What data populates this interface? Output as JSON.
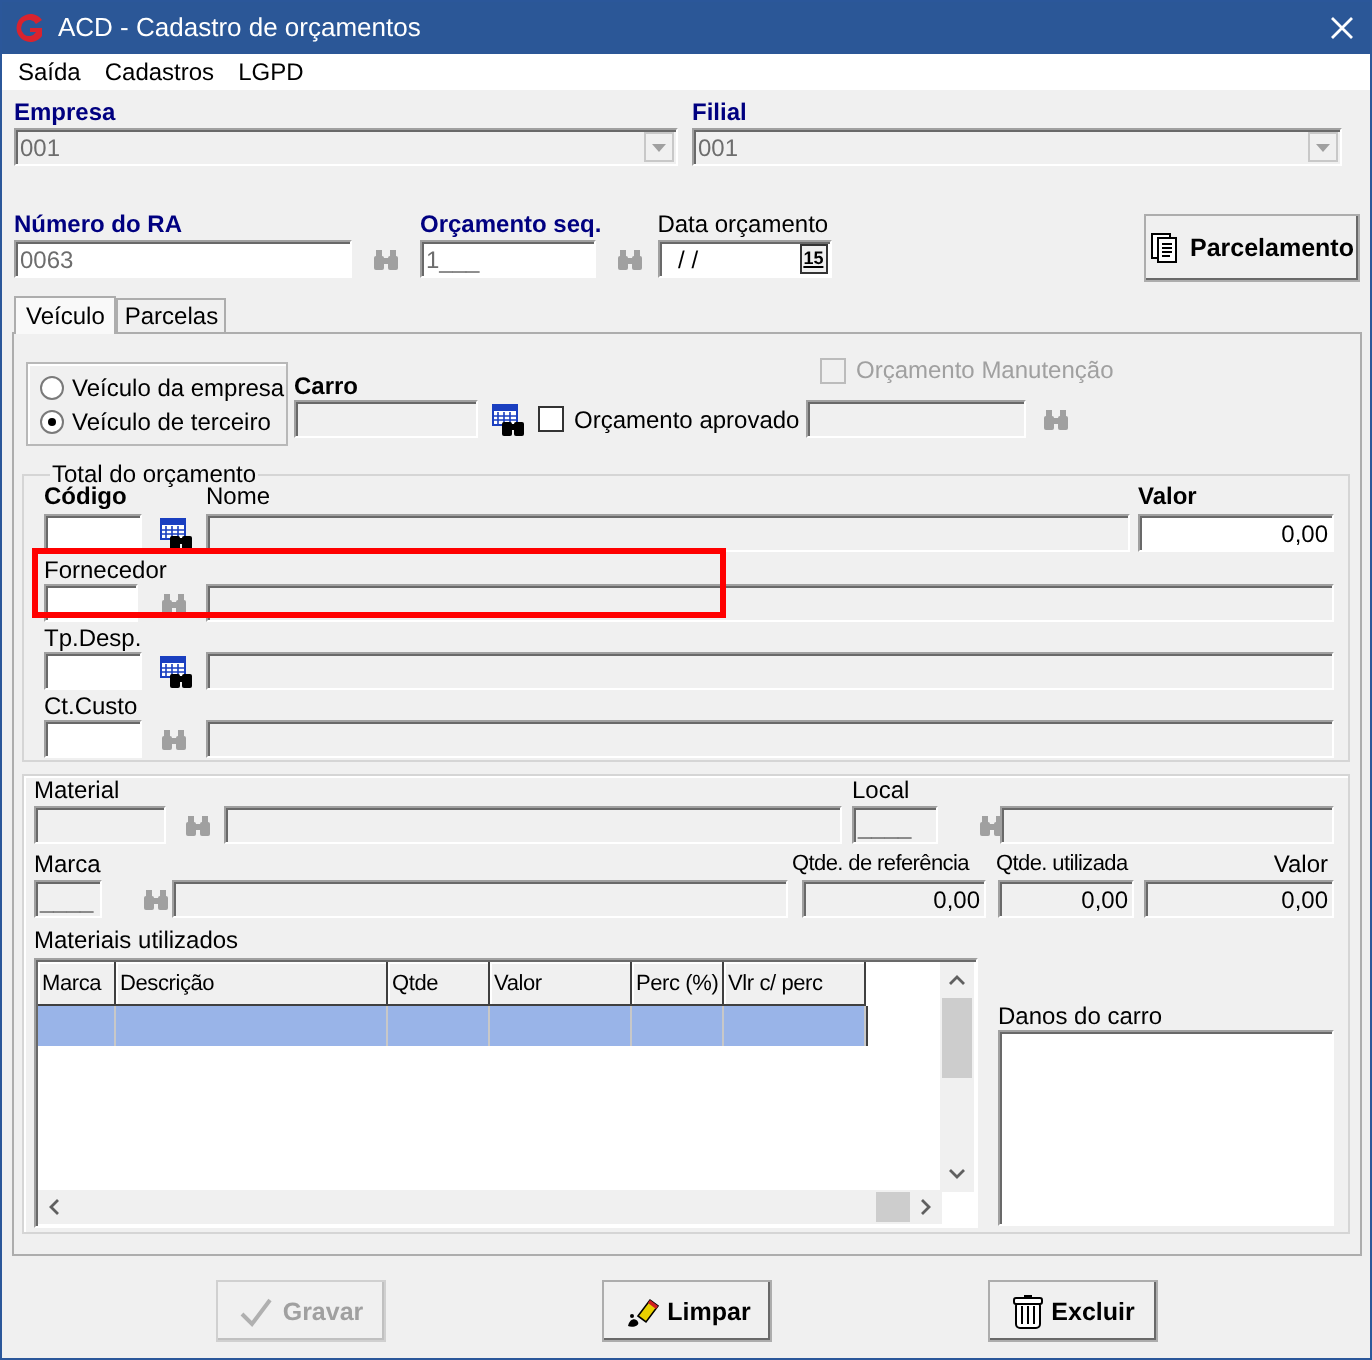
{
  "window": {
    "title": "ACD - Cadastro de orçamentos"
  },
  "menu": [
    "Saída",
    "Cadastros",
    "LGPD"
  ],
  "empresa": {
    "label": "Empresa",
    "value": "001",
    "disabled": true
  },
  "filial": {
    "label": "Filial",
    "value": "001",
    "disabled": true
  },
  "numero_ra": {
    "label": "Número do RA",
    "value": "0063"
  },
  "orcamento_seq": {
    "label": "Orçamento seq.",
    "value": "1___"
  },
  "data_orcamento": {
    "label": "Data orçamento",
    "value": " / /",
    "calendar_day": "15"
  },
  "parcelamento_button": "Parcelamento",
  "tabs": [
    {
      "label": "Veículo",
      "selected": true
    },
    {
      "label": "Parcelas",
      "selected": false
    }
  ],
  "vehicle_type": [
    {
      "label": "Veículo da empresa",
      "selected": false
    },
    {
      "label": "Veículo de terceiro",
      "selected": true
    }
  ],
  "carro": {
    "label": "Carro"
  },
  "orcamento_manutencao": {
    "label": "Orçamento Manutenção",
    "checked": false,
    "disabled": true
  },
  "orcamento_aprovado": {
    "label": "Orçamento aprovado",
    "checked": false,
    "disabled": false
  },
  "total": {
    "title": "Total do orçamento",
    "codigo_label": "Código",
    "nome_label": "Nome",
    "valor_label": "Valor",
    "valor": "0,00",
    "fornecedor_label": "Fornecedor",
    "tp_desp_label": "Tp.Desp.",
    "ct_custo_label": "Ct.Custo"
  },
  "material": {
    "material_label": "Material",
    "local_label": "Local",
    "local_value": "____",
    "marca_label": "Marca",
    "marca_value": "____",
    "qtde_ref_label": "Qtde. de referência",
    "qtde_ref": "0,00",
    "qtde_util_label": "Qtde. utilizada",
    "qtde_util": "0,00",
    "valor_label": "Valor",
    "valor": "0,00"
  },
  "materiais_utilizados": {
    "title": "Materiais utilizados",
    "columns": [
      "Marca",
      "Descrição",
      "Qtde",
      "Valor",
      "Perc (%)",
      "Vlr c/ perc"
    ],
    "rows": [
      {
        "selected": true
      }
    ]
  },
  "danos_label": "Danos do carro",
  "buttons": [
    {
      "kind": "save",
      "label": "Gravar",
      "disabled": true
    },
    {
      "kind": "clear",
      "label": "Limpar",
      "disabled": false
    },
    {
      "kind": "delete",
      "label": "Excluir",
      "disabled": false
    }
  ]
}
